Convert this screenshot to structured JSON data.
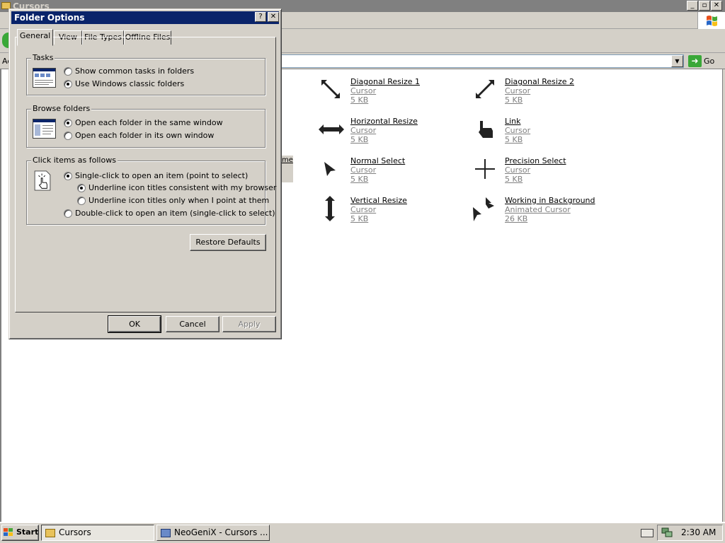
{
  "explorer": {
    "title": "Cursors",
    "address_label": "Ad",
    "go_label": "Go",
    "column_header_fragment": "me",
    "files": [
      {
        "name": "Diagonal Resize 1",
        "type": "Cursor",
        "size": "5 KB",
        "icon": "diagonal-resize-1-icon"
      },
      {
        "name": "Diagonal Resize 2",
        "type": "Cursor",
        "size": "5 KB",
        "icon": "diagonal-resize-2-icon"
      },
      {
        "name": "Horizontal Resize",
        "type": "Cursor",
        "size": "5 KB",
        "icon": "horizontal-resize-icon"
      },
      {
        "name": "Link",
        "type": "Cursor",
        "size": "5 KB",
        "icon": "link-hand-icon"
      },
      {
        "name": "Normal Select",
        "type": "Cursor",
        "size": "5 KB",
        "icon": "normal-select-arrow-icon"
      },
      {
        "name": "Precision Select",
        "type": "Cursor",
        "size": "5 KB",
        "icon": "precision-crosshair-icon"
      },
      {
        "name": "Vertical Resize",
        "type": "Cursor",
        "size": "5 KB",
        "icon": "vertical-resize-icon"
      },
      {
        "name": "Working in Background",
        "type": "Animated Cursor",
        "size": "26 KB",
        "icon": "working-in-background-icon"
      }
    ]
  },
  "dialog": {
    "title": "Folder Options",
    "help_glyph": "?",
    "close_glyph": "✕",
    "tabs": [
      {
        "label": "General",
        "active": true
      },
      {
        "label": "View",
        "active": false
      },
      {
        "label": "File Types",
        "active": false
      },
      {
        "label": "Offline Files",
        "active": false
      }
    ],
    "tasks": {
      "label": "Tasks",
      "options": [
        {
          "label": "Show common tasks in folders",
          "selected": false
        },
        {
          "label": "Use Windows classic folders",
          "selected": true
        }
      ]
    },
    "browse": {
      "label": "Browse folders",
      "options": [
        {
          "label": "Open each folder in the same window",
          "selected": true
        },
        {
          "label": "Open each folder in its own window",
          "selected": false
        }
      ]
    },
    "click": {
      "label": "Click items as follows",
      "options": [
        {
          "label": "Single-click to open an item (point to select)",
          "selected": true
        },
        {
          "label": "Underline icon titles consistent with my browser",
          "selected": true
        },
        {
          "label": "Underline icon titles only when I point at them",
          "selected": false
        },
        {
          "label": "Double-click to open an item (single-click to select)",
          "selected": false
        }
      ]
    },
    "restore_defaults": "Restore Defaults",
    "ok": "OK",
    "cancel": "Cancel",
    "apply": "Apply"
  },
  "taskbar": {
    "start": "Start",
    "tasks": [
      {
        "label": "Cursors",
        "active": true
      },
      {
        "label": "NeoGeniX - Cursors ...",
        "active": false
      }
    ],
    "clock": "2:30 AM"
  },
  "colors": {
    "dialog_title_bg": "#0a246a",
    "face": "#d4d0c8",
    "shadow": "#808080"
  }
}
